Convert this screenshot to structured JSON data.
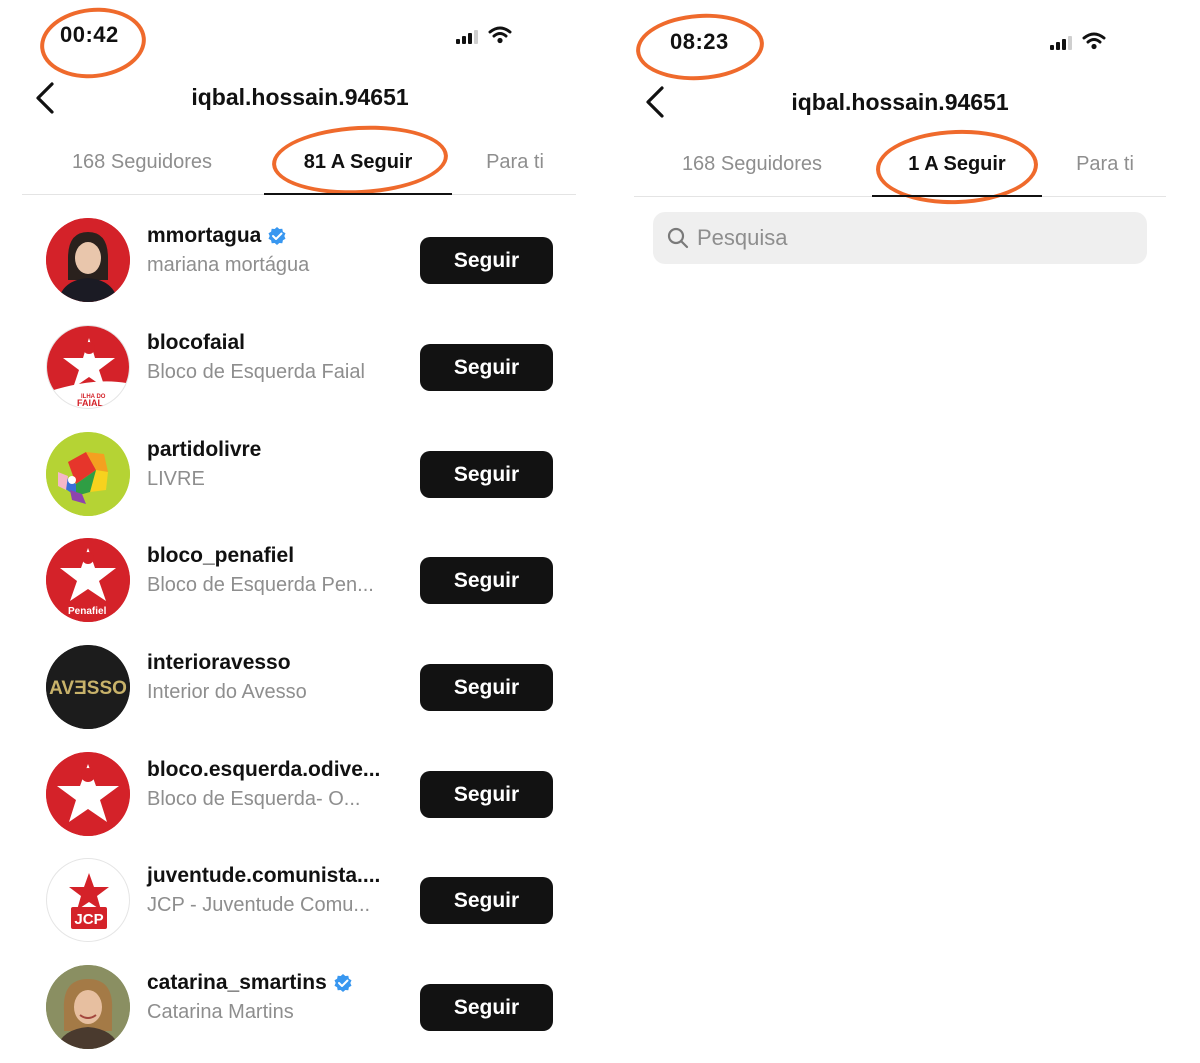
{
  "left": {
    "time": "00:42",
    "title": "iqbal.hossain.94651",
    "tabs": [
      "168 Seguidores",
      "81 A Seguir",
      "Para ti"
    ],
    "follow_label": "Seguir",
    "accounts": [
      {
        "username": "mmortagua",
        "name": "mariana mortágua",
        "verified": true,
        "avatar": "portrait-dark-hair"
      },
      {
        "username": "blocofaial",
        "name": "Bloco de Esquerda Faial",
        "verified": false,
        "avatar": "bloco-star-logo",
        "avatar_text": "ILHA DO FAIAL"
      },
      {
        "username": "partidolivre",
        "name": "LIVRE",
        "verified": false,
        "avatar": "livre-rainbow-logo"
      },
      {
        "username": "bloco_penafiel",
        "name": "Bloco de Esquerda Pen...",
        "verified": false,
        "avatar": "bloco-star-logo",
        "avatar_text": "Penafiel"
      },
      {
        "username": "interioravesso",
        "name": "Interior do Avesso",
        "verified": false,
        "avatar": "avesso-logo",
        "avatar_text": "AVƎSSO"
      },
      {
        "username": "bloco.esquerda.odive...",
        "name": "Bloco de Esquerda- O...",
        "verified": false,
        "avatar": "bloco-star-logo"
      },
      {
        "username": "juventude.comunista....",
        "name": "JCP - Juventude Comu...",
        "verified": false,
        "avatar": "jcp-logo",
        "avatar_text": "JCP"
      },
      {
        "username": "catarina_smartins",
        "name": "Catarina Martins",
        "verified": true,
        "avatar": "portrait-light-hair"
      }
    ]
  },
  "right": {
    "time": "08:23",
    "title": "iqbal.hossain.94651",
    "tabs": [
      "168 Seguidores",
      "1 A Seguir",
      "Para ti"
    ],
    "search": {
      "placeholder": "Pesquisa"
    }
  },
  "colors": {
    "highlight_circle": "#ef6a2c",
    "button_bg": "#121212",
    "verified": "#3897f0",
    "bloco_red": "#d42229",
    "livre_green": "#b5d334"
  }
}
